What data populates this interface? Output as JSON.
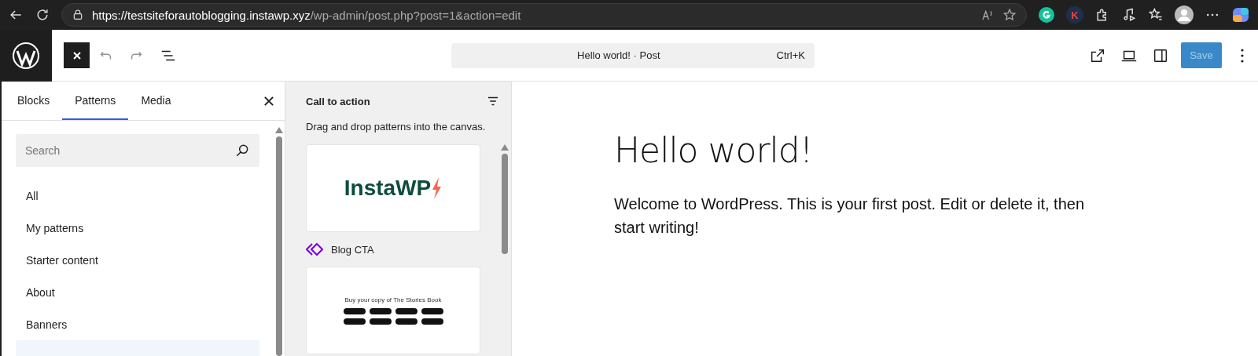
{
  "browser": {
    "url_host": "https://testsiteforautoblogging.instawp.xyz",
    "url_path": "/wp-admin/post.php?post=1&action=edit",
    "extension_letter": "K"
  },
  "header": {
    "command_title": "Hello world! · Post",
    "shortcut": "Ctrl+K",
    "save_label": "Save",
    "save_disabled": true
  },
  "inserter": {
    "tabs": [
      {
        "label": "Blocks",
        "selected": false
      },
      {
        "label": "Patterns",
        "selected": true
      },
      {
        "label": "Media",
        "selected": false
      }
    ],
    "search": {
      "placeholder": "Search"
    },
    "categories": [
      {
        "label": "All",
        "selected": false
      },
      {
        "label": "My patterns",
        "selected": false
      },
      {
        "label": "Starter content",
        "selected": false
      },
      {
        "label": "About",
        "selected": false
      },
      {
        "label": "Banners",
        "selected": false
      },
      {
        "selected": true
      }
    ]
  },
  "patterns_panel": {
    "title": "Call to action",
    "hint": "Drag and drop patterns into the canvas.",
    "patterns": [
      {
        "kind": "logo",
        "logo_text": "InstaWP",
        "name": "Blog CTA",
        "synced": true
      },
      {
        "kind": "book",
        "heading": "Buy your copy of The Stories Book"
      }
    ]
  },
  "post": {
    "title": "Hello world!",
    "body": "Welcome to WordPress. This is your first post. Edit or delete it, then start writing!"
  }
}
